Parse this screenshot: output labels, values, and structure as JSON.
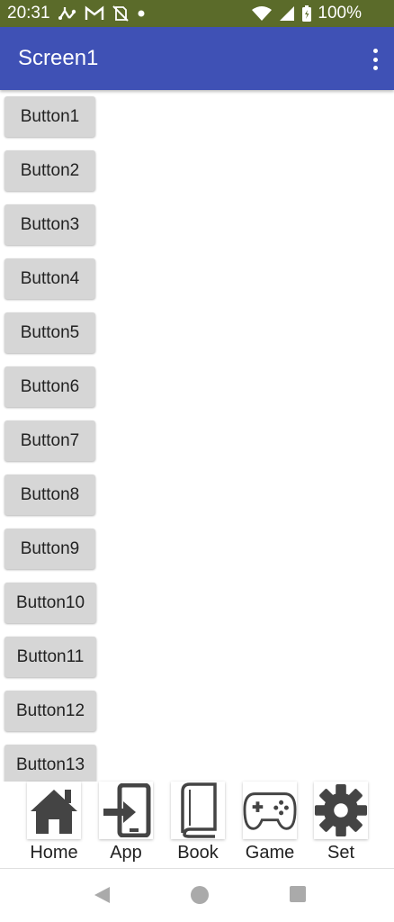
{
  "status_bar": {
    "time": "20:31",
    "battery": "100%",
    "icons": [
      "usb-debug-icon",
      "gmail-icon",
      "no-sim-icon",
      "notification-dot-icon",
      "wifi-icon",
      "signal-icon",
      "battery-charging-icon"
    ]
  },
  "app_bar": {
    "title": "Screen1",
    "menu_icon": "overflow-menu-icon"
  },
  "buttons": [
    "Button1",
    "Button2",
    "Button3",
    "Button4",
    "Button5",
    "Button6",
    "Button7",
    "Button8",
    "Button9",
    "Button10",
    "Button11",
    "Button12",
    "Button13"
  ],
  "bottom_nav": [
    {
      "label": "Home",
      "icon": "home-icon"
    },
    {
      "label": "App",
      "icon": "app-enter-icon"
    },
    {
      "label": "Book",
      "icon": "book-icon"
    },
    {
      "label": "Game",
      "icon": "gamepad-icon"
    },
    {
      "label": "Set",
      "icon": "gear-icon"
    }
  ],
  "system_nav": [
    "back-icon",
    "home-circle-icon",
    "recents-icon"
  ],
  "colors": {
    "status_bar": "#5b6b2a",
    "app_bar": "#3f51b5",
    "button": "#d6d6d6",
    "icon": "#444444"
  }
}
